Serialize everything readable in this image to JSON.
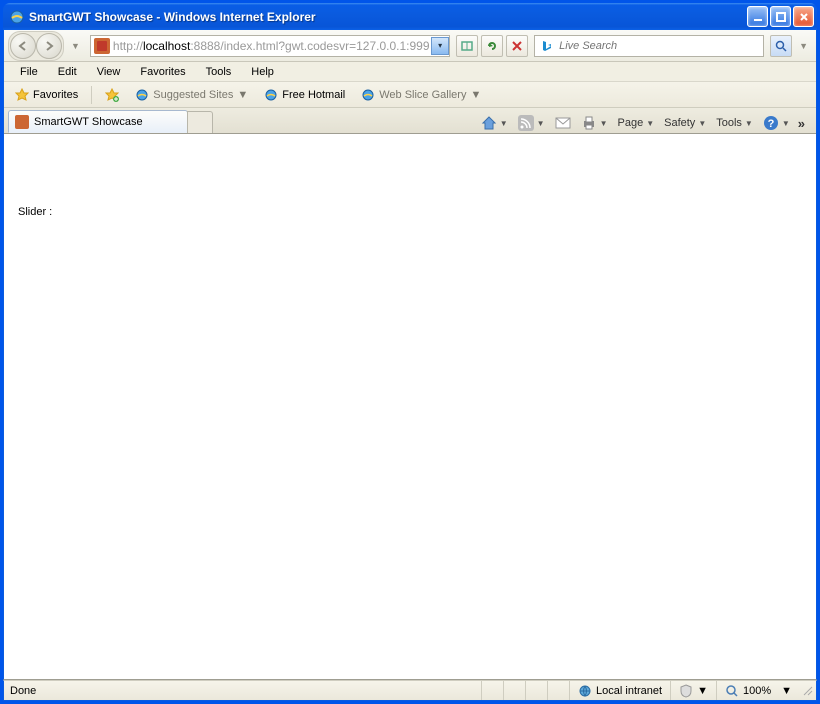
{
  "window": {
    "title": "SmartGWT Showcase - Windows Internet Explorer"
  },
  "nav": {
    "url_prefix": "http://",
    "url_host": "localhost",
    "url_rest": ":8888/index.html?gwt.codesvr=127.0.0.1:999",
    "search_placeholder": "Live Search"
  },
  "menubar": {
    "items": [
      "File",
      "Edit",
      "View",
      "Favorites",
      "Tools",
      "Help"
    ]
  },
  "favbar": {
    "favorites_label": "Favorites",
    "suggested_label": "Suggested Sites",
    "hotmail_label": "Free Hotmail",
    "slice_label": "Web Slice Gallery"
  },
  "tab": {
    "title": "SmartGWT Showcase"
  },
  "commandbar": {
    "page": "Page",
    "safety": "Safety",
    "tools": "Tools"
  },
  "content": {
    "label": "Slider :"
  },
  "status": {
    "done": "Done",
    "zone": "Local intranet",
    "zoom": "100%"
  }
}
